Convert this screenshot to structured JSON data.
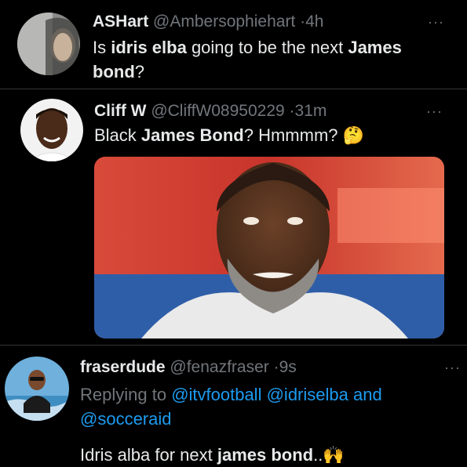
{
  "tweets": [
    {
      "name": "ASHart",
      "handle": "@Ambersophiehart",
      "sep": "·",
      "time": "4h",
      "text_parts": [
        "Is ",
        "idris elba",
        " going to be the next ",
        "James",
        "bond",
        "?"
      ]
    },
    {
      "name": "Cliff W",
      "handle": "@CliffW08950229",
      "sep": "·",
      "time": "31m",
      "text_parts": [
        "Black ",
        "James Bond",
        "? Hmmmm? "
      ],
      "emoji": "🤔"
    },
    {
      "name": "fraserdude",
      "handle": "@fenazfraser",
      "sep": "·",
      "time": "9s",
      "reply_prefix": "Replying to ",
      "reply_mentions": [
        "@itvfootball",
        "@idriselba",
        "and",
        "@socceraid"
      ],
      "text_parts": [
        "Idris alba for next ",
        "james bond",
        ".."
      ],
      "emoji": "🙌"
    }
  ],
  "more_label": "···",
  "colors": {
    "background": "#000000",
    "text": "#e7e9ea",
    "muted": "#71767b",
    "link": "#1d9bf0",
    "divider": "#2f3336"
  }
}
